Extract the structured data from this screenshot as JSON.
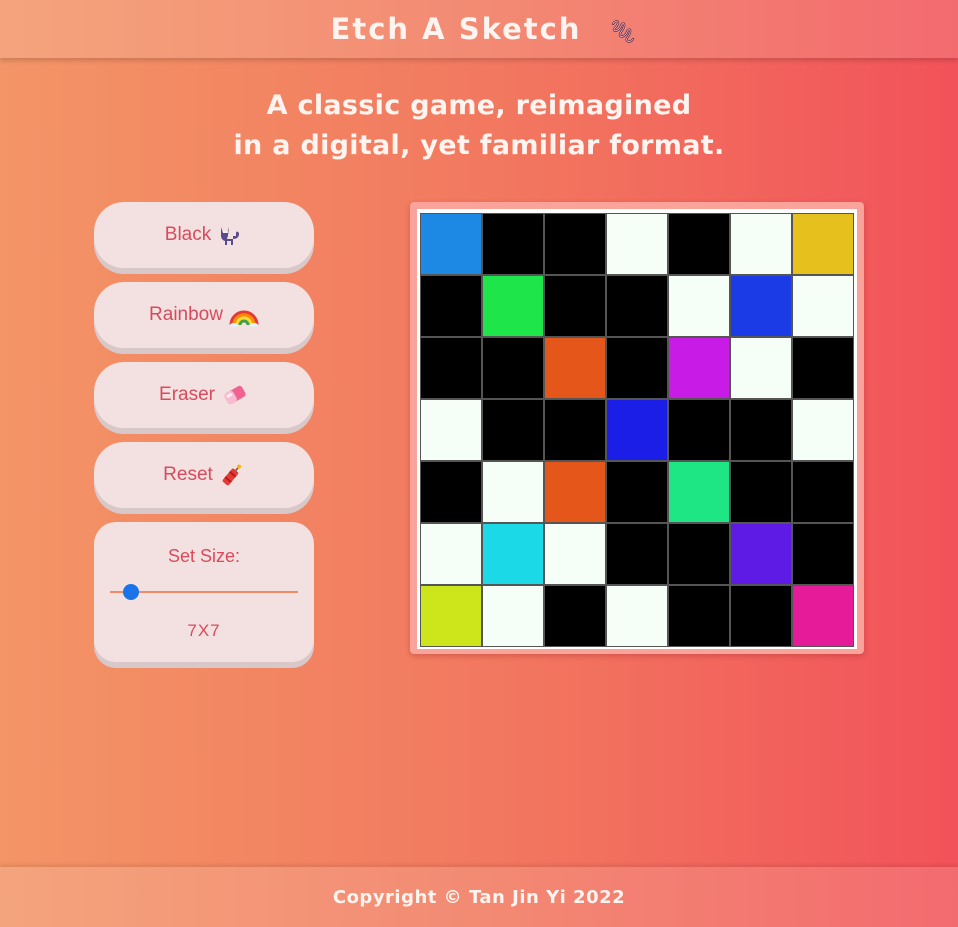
{
  "header": {
    "title": "Etch A Sketch",
    "icon": "scribble-icon"
  },
  "tagline": {
    "line1": "A classic game, reimagined",
    "line2": "in a digital, yet familiar format."
  },
  "controls": {
    "black_label": "Black",
    "black_icon": "black-cat-icon",
    "rainbow_label": "Rainbow",
    "rainbow_icon": "rainbow-icon",
    "eraser_label": "Eraser",
    "eraser_icon": "eraser-icon",
    "reset_label": "Reset",
    "reset_icon": "firecracker-icon"
  },
  "size": {
    "label": "Set Size:",
    "value_text": "7X7",
    "value": 7
  },
  "grid": {
    "size": 7,
    "cells": [
      [
        "#1e88e5",
        "#000000",
        "#000000",
        "#f5fff8",
        "#000000",
        "#f5fff8",
        "#e6c01c"
      ],
      [
        "#000000",
        "#1ee64a",
        "#000000",
        "#000000",
        "#f5fff8",
        "#1b3be6",
        "#f5fff8"
      ],
      [
        "#000000",
        "#000000",
        "#e5561a",
        "#000000",
        "#c81be6",
        "#f5fff8",
        "#000000"
      ],
      [
        "#f5fff8",
        "#000000",
        "#000000",
        "#1b1ee6",
        "#000000",
        "#000000",
        "#f5fff8"
      ],
      [
        "#000000",
        "#f5fff8",
        "#e5561a",
        "#000000",
        "#1ee684",
        "#000000",
        "#000000"
      ],
      [
        "#f5fff8",
        "#1bd9e6",
        "#f5fff8",
        "#000000",
        "#000000",
        "#5e1be6",
        "#000000"
      ],
      [
        "#cde61b",
        "#f5fff8",
        "#000000",
        "#f5fff8",
        "#000000",
        "#000000",
        "#e61b9a"
      ]
    ]
  },
  "footer": {
    "copyright": "Copyright © Tan Jin Yi 2022"
  },
  "colors": {
    "accent": "#d94b5c",
    "button_bg": "#f2e1e0",
    "slider": "#1a73e8"
  }
}
